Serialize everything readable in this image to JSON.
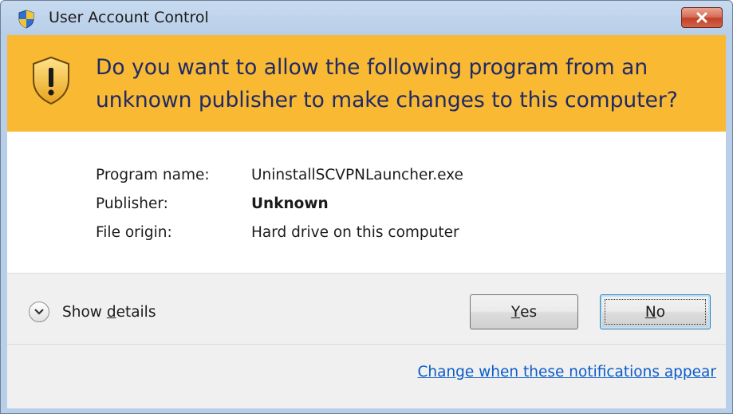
{
  "window": {
    "title": "User Account Control",
    "close_icon": "close-icon",
    "shield_icon": "uac-shield-icon"
  },
  "banner": {
    "icon": "warning-shield-icon",
    "question": "Do you want to allow the following program from an unknown publisher to make changes to this computer?",
    "color": "#f9b933"
  },
  "info": {
    "rows": [
      {
        "label": "Program name:",
        "value": "UninstallSCVPNLauncher.exe"
      },
      {
        "label": "Publisher:",
        "value": "Unknown"
      },
      {
        "label": "File origin:",
        "value": "Hard drive on this computer"
      }
    ]
  },
  "footer": {
    "details_pre": "Show ",
    "details_access": "d",
    "details_post": "etails",
    "yes_access": "Y",
    "yes_rest": "es",
    "no_access": "N",
    "no_rest": "o",
    "change_link": "Change when these notifications appear"
  }
}
